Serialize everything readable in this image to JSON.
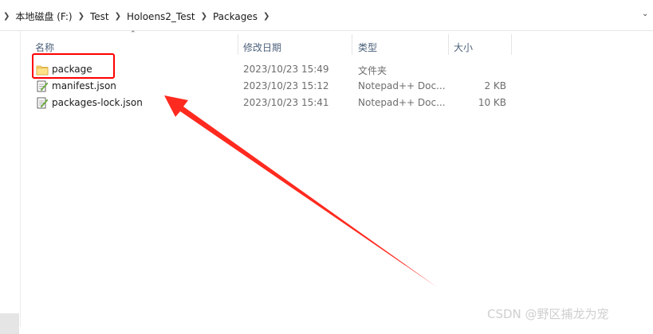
{
  "address_bar": {
    "breadcrumbs": [
      "本地磁盘 (F:)",
      "Test",
      "Holoens2_Test",
      "Packages"
    ],
    "separator_icon": "chevron-right-icon",
    "dropdown_icon": "chevron-down-icon"
  },
  "columns": {
    "name": "名称",
    "date": "修改日期",
    "type": "类型",
    "size": "大小",
    "sort_icon": "sort-up-icon"
  },
  "files": [
    {
      "name": "package",
      "date": "2023/10/23 15:49",
      "type": "文件夹",
      "size": "",
      "icon": "folder-icon"
    },
    {
      "name": "manifest.json",
      "date": "2023/10/23 15:12",
      "type": "Notepad++ Doc...",
      "size": "2 KB",
      "icon": "notepadpp-file-icon"
    },
    {
      "name": "packages-lock.json",
      "date": "2023/10/23 15:41",
      "type": "Notepad++ Doc...",
      "size": "10 KB",
      "icon": "notepadpp-file-icon"
    }
  ],
  "annotation": {
    "highlight_color": "#ff0000",
    "arrow_color": "#ff2a1f"
  },
  "watermark": "CSDN @野区捕龙为宠"
}
